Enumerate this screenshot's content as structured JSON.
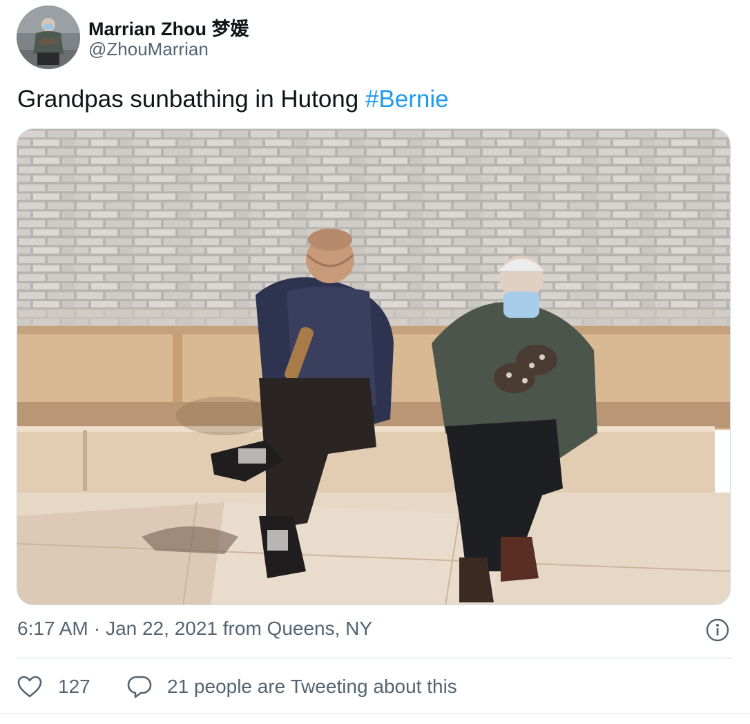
{
  "author": {
    "name": "Marrian Zhou 梦媛",
    "handle": "@ZhouMarrian",
    "avatar_icon": "avatar-photo"
  },
  "tweet": {
    "text": "Grandpas sunbathing in Hutong ",
    "hashtag": "#Bernie",
    "media_description_icon": "photo"
  },
  "meta": {
    "time": "6:17 AM",
    "separator": "·",
    "date": "Jan 22, 2021",
    "from_label": "from",
    "location": "Queens, NY",
    "info_icon": "info-circle-icon"
  },
  "actions": {
    "like_icon": "heart-icon",
    "like_count": "127",
    "conversation_icon": "speech-bubble-icon",
    "conversation_text": "21 people are Tweeting about this"
  },
  "colors": {
    "accent": "#1d9bf0",
    "secondary_text": "#536471",
    "primary_text": "#0f1419",
    "border": "#cfd9de"
  }
}
